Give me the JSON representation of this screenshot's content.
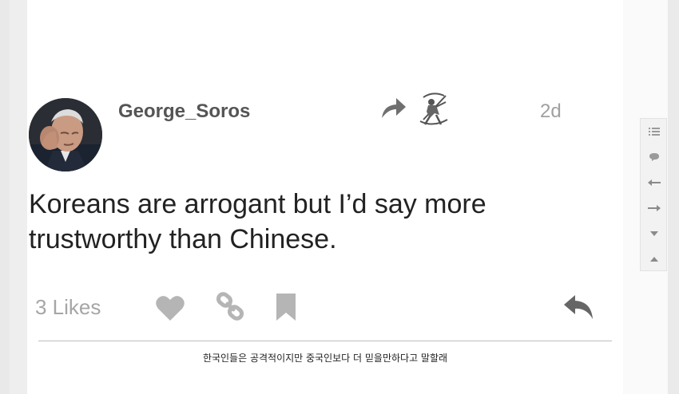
{
  "post": {
    "username": "George_Soros",
    "time": "2d",
    "text": "Koreans are arrogant but I’d say more trustworthy than Chinese.",
    "likes": "3 Likes"
  },
  "caption": "한국인들은 공격적이지만 중국인보다 더 믿을만하다고 말할래",
  "icons": {
    "share": "share-arrow-icon",
    "badge": "archer-badge-icon",
    "heart": "heart-icon",
    "link": "link-icon",
    "bookmark": "bookmark-icon",
    "reply": "reply-icon"
  },
  "side_toolbar": [
    "list-icon",
    "comment-icon",
    "arrow-left-icon",
    "arrow-right-icon",
    "caret-down-icon",
    "caret-up-icon"
  ],
  "colors": {
    "text": "#222222",
    "username": "#555555",
    "muted": "#a6a6a6",
    "icon": "#999999"
  }
}
